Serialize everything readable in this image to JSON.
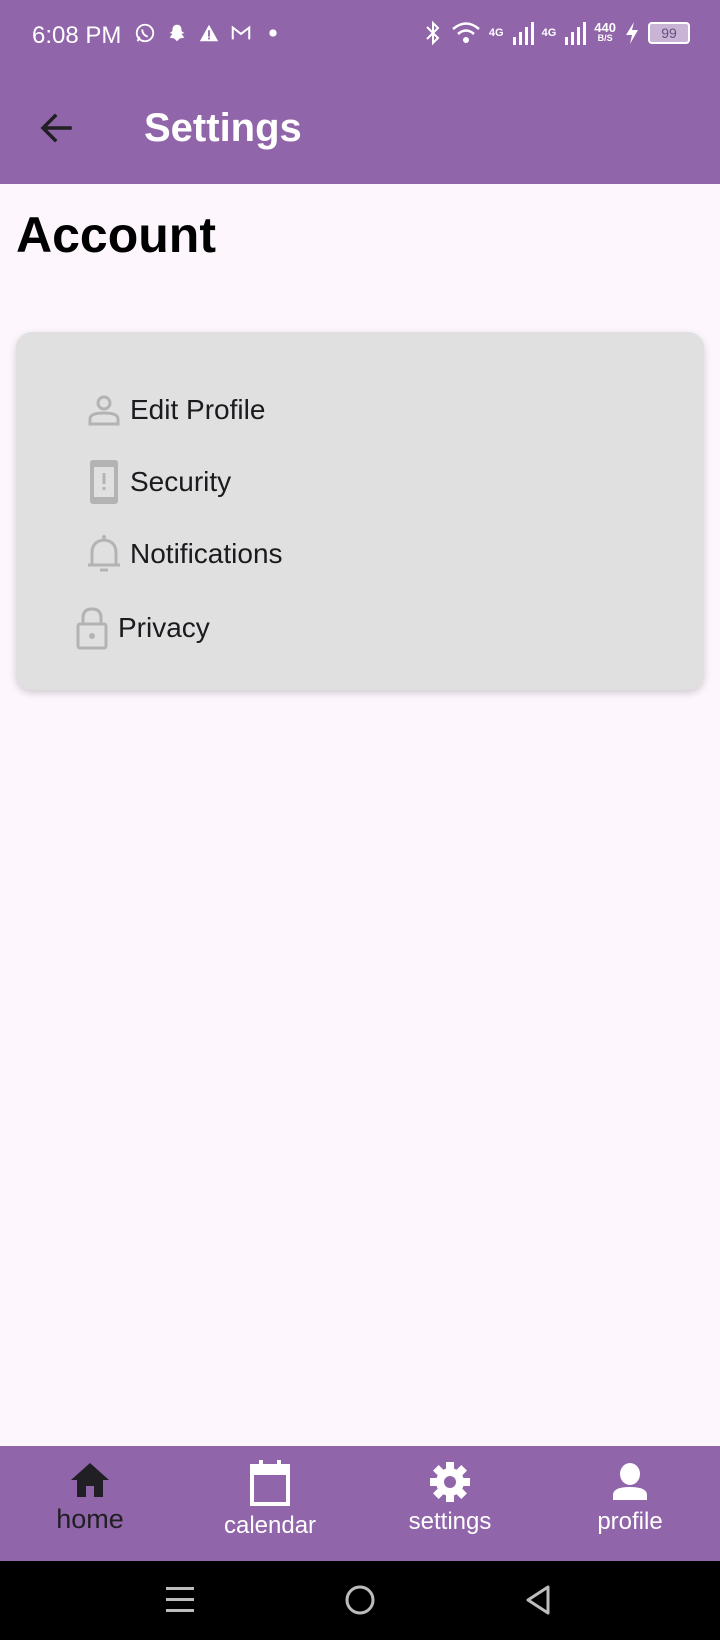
{
  "status_bar": {
    "time": "6:08 PM",
    "network_speed_value": "440",
    "network_speed_unit": "B/S",
    "battery": "99",
    "net_type_1": "4G",
    "net_type_2": "4G"
  },
  "app_bar": {
    "title": "Settings"
  },
  "section": {
    "title": "Account"
  },
  "menu": {
    "items": [
      {
        "label": "Edit Profile",
        "icon": "person-outline-icon"
      },
      {
        "label": "Security",
        "icon": "phone-alert-icon"
      },
      {
        "label": "Notifications",
        "icon": "bell-icon"
      },
      {
        "label": "Privacy",
        "icon": "lock-icon"
      }
    ]
  },
  "bottom_nav": {
    "items": [
      {
        "label": "home",
        "icon": "home-icon",
        "active": true
      },
      {
        "label": "calendar",
        "icon": "calendar-icon",
        "active": false
      },
      {
        "label": "settings",
        "icon": "gear-icon",
        "active": false
      },
      {
        "label": "profile",
        "icon": "person-icon",
        "active": false
      }
    ]
  },
  "colors": {
    "primary": "#9165a9",
    "background": "#fdf7fd",
    "card": "#e0e0e0",
    "icon_grey": "#b3b3b3"
  }
}
